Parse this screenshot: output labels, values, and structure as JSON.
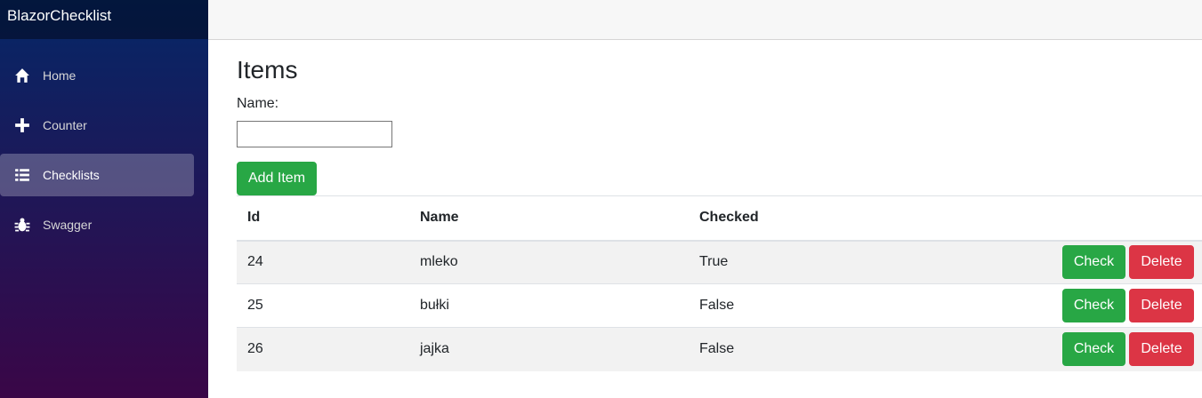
{
  "app": {
    "brand": "BlazorChecklist"
  },
  "sidebar": {
    "items": [
      {
        "label": "Home",
        "icon": "home-icon",
        "active": false
      },
      {
        "label": "Counter",
        "icon": "plus-icon",
        "active": false
      },
      {
        "label": "Checklists",
        "icon": "list-icon",
        "active": true
      },
      {
        "label": "Swagger",
        "icon": "bug-icon",
        "active": false
      }
    ]
  },
  "page": {
    "title": "Items",
    "name_label": "Name:",
    "name_value": "",
    "add_button": "Add Item"
  },
  "table": {
    "columns": [
      "Id",
      "Name",
      "Checked"
    ],
    "rows": [
      {
        "id": "24",
        "name": "mleko",
        "checked": "True"
      },
      {
        "id": "25",
        "name": "bułki",
        "checked": "False"
      },
      {
        "id": "26",
        "name": "jajka",
        "checked": "False"
      }
    ],
    "check_label": "Check",
    "delete_label": "Delete"
  },
  "colors": {
    "sidebar_top": "#052767",
    "sidebar_bottom": "#3a0647",
    "success": "#28a745",
    "danger": "#dc3545"
  }
}
